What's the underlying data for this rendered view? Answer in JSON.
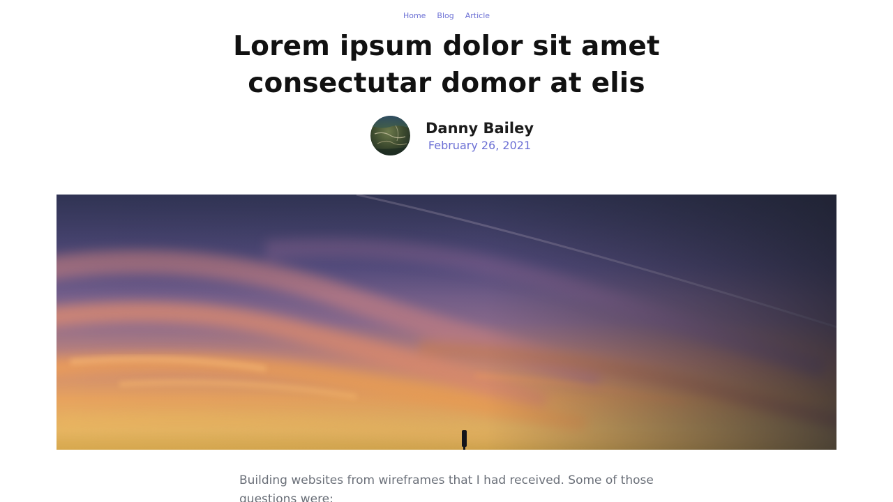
{
  "breadcrumb": {
    "items": [
      "Home",
      "Blog",
      "Article"
    ]
  },
  "article": {
    "title_lines": [
      "Lorem ipsum dolor sit amet",
      "consectutar domor at elis"
    ],
    "author": {
      "name": "Danny Bailey",
      "date": "February 26, 2021"
    },
    "intro": "Building websites from wireframes that I had received. Some of those questions were:"
  },
  "colors": {
    "link": "#6b6fd4",
    "title": "#111111",
    "body_text": "#6a6f78"
  },
  "images": {
    "avatar_icon": "landscape-avatar",
    "hero_icon": "sunset-sky-photo"
  }
}
